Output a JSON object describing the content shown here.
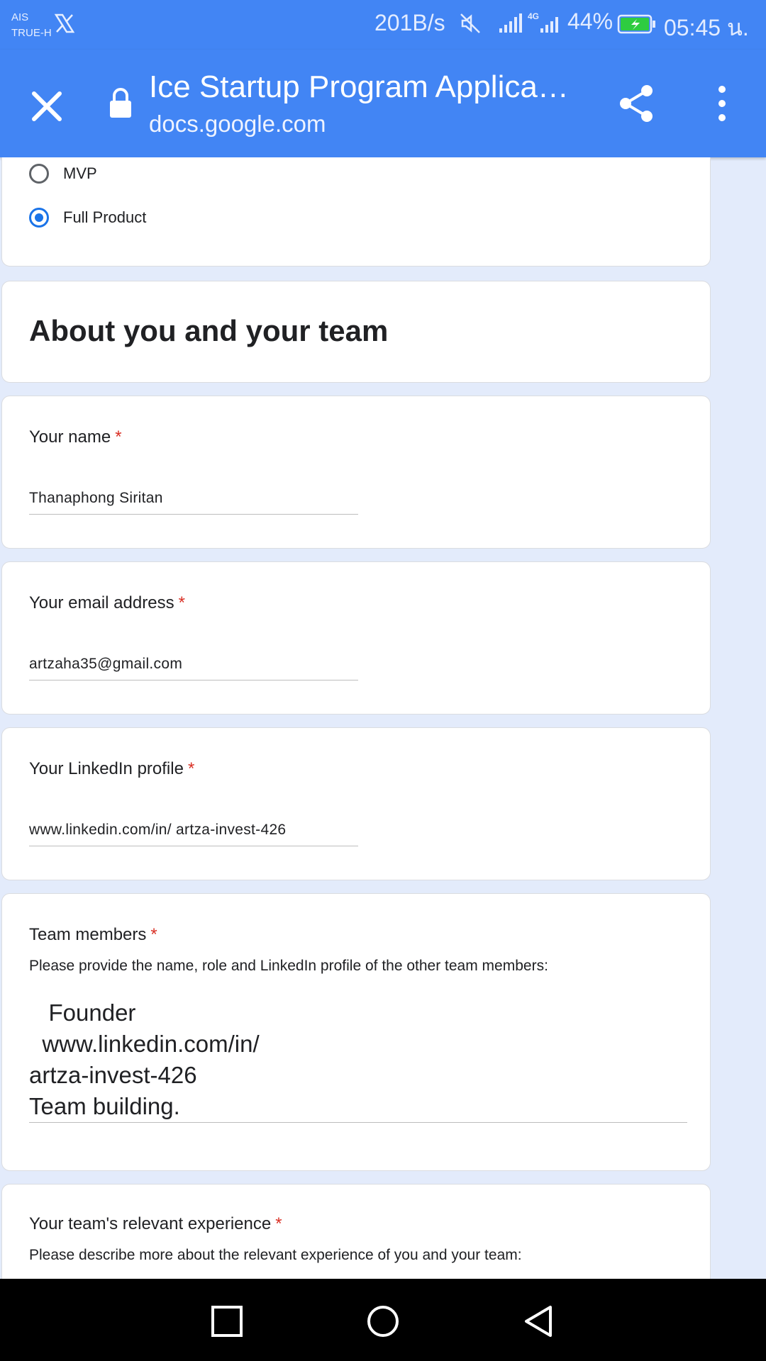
{
  "status_bar": {
    "carrier_line1": "AIS",
    "carrier_line2": "TRUE-H",
    "net_speed": "201B/s",
    "network_type": "4G",
    "battery": "44%",
    "time": "05:45 น."
  },
  "toolbar": {
    "title": "Ice Startup Program Applicat…",
    "url": "docs.google.com",
    "close_icon": "close-icon",
    "share_icon": "share-icon",
    "more_icon": "more-vert-icon"
  },
  "stage_question": {
    "options": [
      {
        "label": "MVP",
        "selected": false
      },
      {
        "label": "Full Product",
        "selected": true
      }
    ]
  },
  "section": {
    "title": "About you and your team"
  },
  "questions": {
    "name": {
      "label": "Your name",
      "required_mark": "*",
      "value": "Thanaphong Siritan"
    },
    "email": {
      "label": "Your email address",
      "required_mark": "*",
      "value": "artzaha35@gmail.com"
    },
    "linkedin": {
      "label": "Your LinkedIn profile",
      "required_mark": "*",
      "value": "www.linkedin.com/in/ artza-invest-426"
    },
    "team_members": {
      "label": "Team members",
      "required_mark": "*",
      "description": "Please provide the name, role and LinkedIn profile of the other team members:",
      "value": "   Founder\n  www.linkedin.com/in/\nartza-invest-426\nTeam building."
    },
    "experience": {
      "label": "Your team's relevant experience",
      "required_mark": "*",
      "description": "Please describe more about the relevant experience of you and your team:"
    }
  },
  "colors": {
    "toolbar_bg": "#4285f4",
    "page_bg": "#e3ebfb",
    "accent": "#1a73e8",
    "required": "#d93025"
  },
  "nav_bar": {
    "icons": [
      "recents-square-icon",
      "home-circle-icon",
      "back-triangle-icon"
    ]
  }
}
